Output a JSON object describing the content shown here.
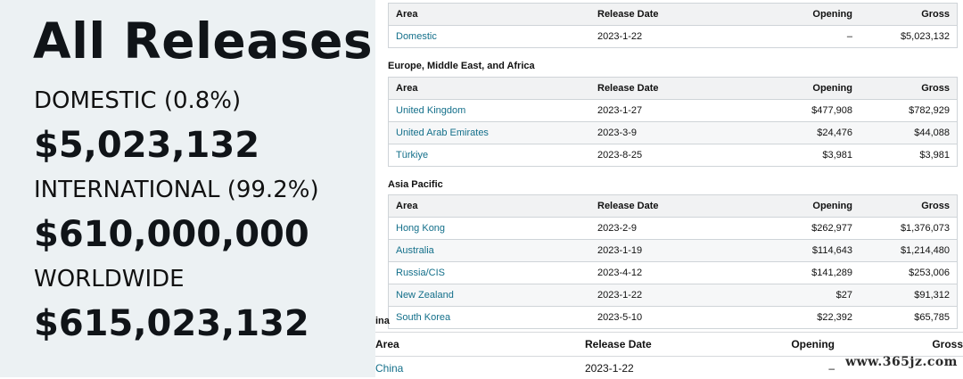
{
  "summary": {
    "title": "All Releases",
    "domestic_label": "DOMESTIC (0.8%)",
    "domestic_amount": "$5,023,132",
    "international_label": "INTERNATIONAL (99.2%)",
    "international_amount": "$610,000,000",
    "worldwide_label": "WORLDWIDE",
    "worldwide_amount": "$615,023,132"
  },
  "columns": {
    "area": "Area",
    "release": "Release Date",
    "opening": "Opening",
    "gross": "Gross"
  },
  "domestic_rows": [
    {
      "area": "Domestic",
      "release": "2023-1-22",
      "opening": "–",
      "gross": "$5,023,132"
    }
  ],
  "emea_title": "Europe, Middle East, and Africa",
  "emea_rows": [
    {
      "area": "United Kingdom",
      "release": "2023-1-27",
      "opening": "$477,908",
      "gross": "$782,929"
    },
    {
      "area": "United Arab Emirates",
      "release": "2023-3-9",
      "opening": "$24,476",
      "gross": "$44,088"
    },
    {
      "area": "Türkiye",
      "release": "2023-8-25",
      "opening": "$3,981",
      "gross": "$3,981"
    }
  ],
  "apac_title": "Asia Pacific",
  "apac_rows": [
    {
      "area": "Hong Kong",
      "release": "2023-2-9",
      "opening": "$262,977",
      "gross": "$1,376,073"
    },
    {
      "area": "Australia",
      "release": "2023-1-19",
      "opening": "$114,643",
      "gross": "$1,214,480"
    },
    {
      "area": "Russia/CIS",
      "release": "2023-4-12",
      "opening": "$141,289",
      "gross": "$253,006"
    },
    {
      "area": "New Zealand",
      "release": "2023-1-22",
      "opening": "$27",
      "gross": "$91,312"
    },
    {
      "area": "South Korea",
      "release": "2023-5-10",
      "opening": "$22,392",
      "gross": "$65,785"
    }
  ],
  "china_fragment": "ina",
  "china_rows": [
    {
      "area": "China",
      "release": "2023-1-22",
      "opening": "–"
    }
  ],
  "watermark": "www.365jz.com"
}
